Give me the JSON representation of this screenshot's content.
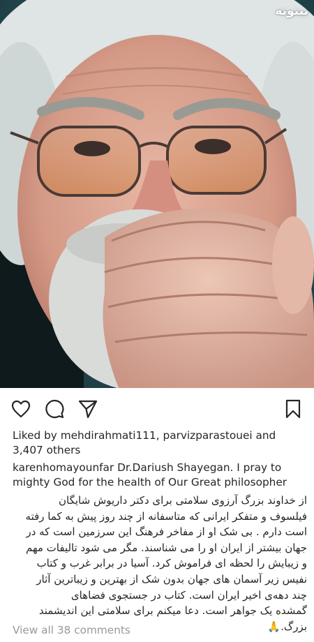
{
  "post": {
    "image_alt": "",
    "watermark": "بیتوته"
  },
  "actions": {
    "like_icon": "heart-icon",
    "comment_icon": "comment-icon",
    "share_icon": "send-icon",
    "save_icon": "bookmark-icon"
  },
  "likes": {
    "prefix": "Liked by ",
    "user1": "mehdirahmati111",
    "sep": ", ",
    "user2": "parvizparastouei",
    "and": " and",
    "others": "3,407 others"
  },
  "caption": {
    "username": "karenhomayounfar",
    "english": " Dr.Dariush Shayegan. I pray to mighty God for the health of Our Great philosopher",
    "persian_lines": [
      "از خداوند بزرگ آرزوی سلامتی برای دکتر داریوش شایگان",
      "فیلسوف و متفکر ایرانی که متاسفانه از چند روز پیش به کما رفته",
      "است دارم . بی شک او از مفاخر فرهنگ این سرزمین است که در",
      "جهان بیشتر از ایران او را می شناسند. مگر می شود تالیفات مهم",
      "و زیبایش را لحظه ای فراموش کرد. آسیا در برابر غرب و کتاب",
      "نفیس زیر آسمان های جهان بدون شک از بهترین و زیباترین آثار",
      "چند دهه‌ی اخیر ایران است. کتاب در جستجوی فضاهای",
      "گمشده یک جواهر است. دعا میکنم برای سلامتی این اندیشمند",
      "بزرگ."
    ],
    "emoji": "🙏"
  },
  "comments": {
    "view_all": "View all 38 comments"
  },
  "colors": {
    "text": "#262626",
    "muted": "#999999",
    "background": "#ffffff"
  }
}
